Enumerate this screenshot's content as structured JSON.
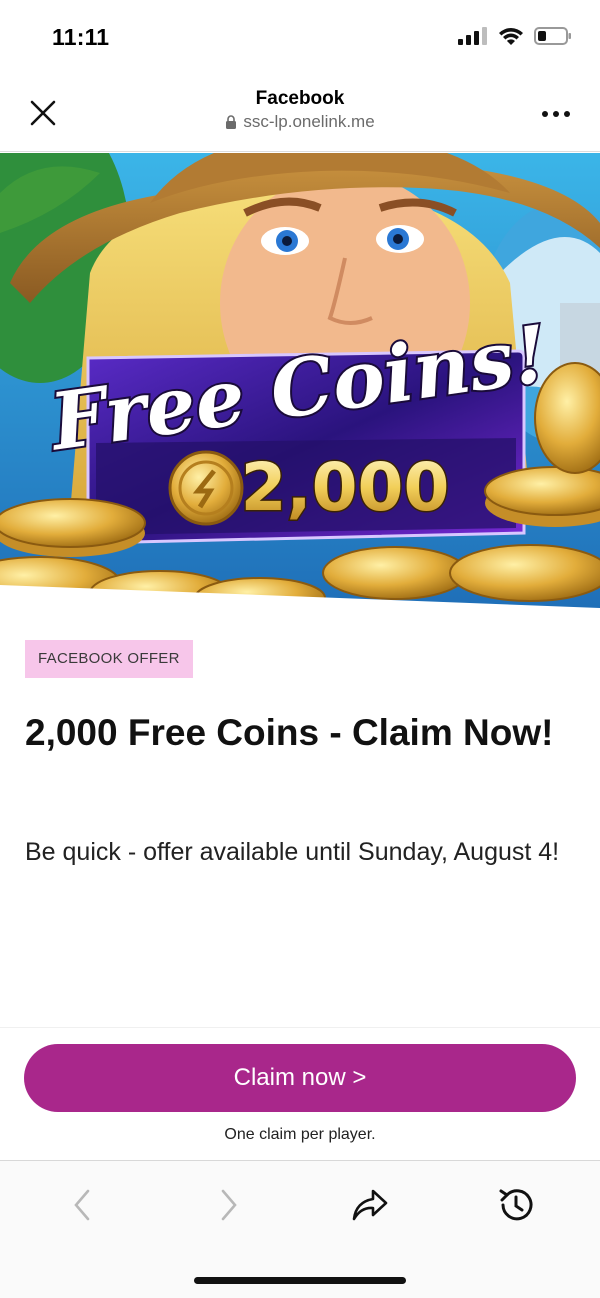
{
  "status_bar": {
    "time": "11:11",
    "signal_icon": "cellular-signal-icon",
    "wifi_icon": "wifi-icon",
    "battery_icon": "battery-icon"
  },
  "browser": {
    "title": "Facebook",
    "url": "ssc-lp.onelink.me",
    "close_icon": "close-icon",
    "lock_icon": "lock-icon",
    "more_icon": "more-icon"
  },
  "hero": {
    "headline": "Free Coins!",
    "amount": "2,000"
  },
  "offer": {
    "badge": "FACEBOOK OFFER",
    "title": "2,000 Free Coins - Claim Now!",
    "description": "Be quick - offer available until Sunday, August 4!"
  },
  "cta": {
    "button_label": "Claim now >",
    "note": "One claim per player."
  },
  "toolbar": {
    "back_icon": "back-icon",
    "forward_icon": "forward-icon",
    "share_icon": "share-icon",
    "history_icon": "history-icon"
  },
  "colors": {
    "accent": "#a9278b",
    "badge_bg": "#f7c6ea",
    "coin_gold": "#e6b54a",
    "banner_purple": "#3b1fa0"
  }
}
